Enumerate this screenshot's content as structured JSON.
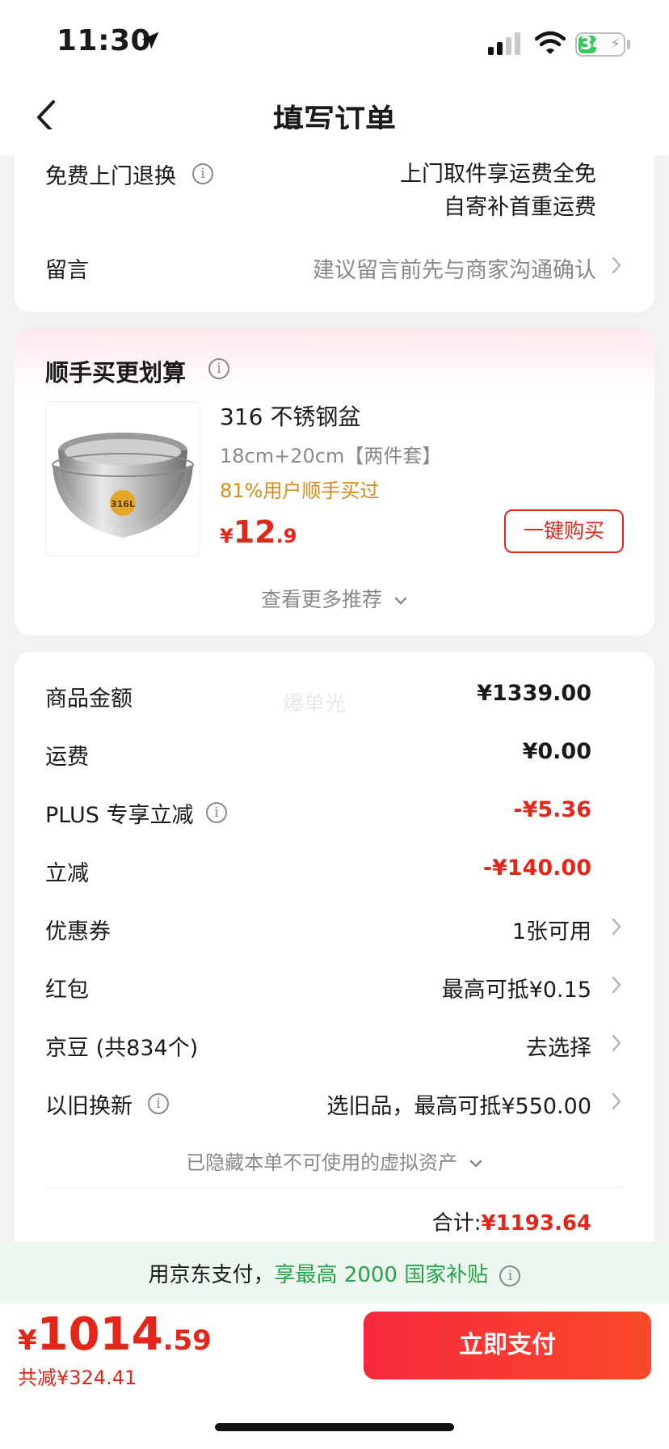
{
  "status": {
    "time": "11:30",
    "battery": "34"
  },
  "nav": {
    "title": "填写订单"
  },
  "service": {
    "return_label": "免费上门退换",
    "return_line1": "上门取件享运费全免",
    "return_line2": "自寄补首重运费",
    "message_label": "留言",
    "message_placeholder": "建议留言前先与商家沟通确认"
  },
  "recommend": {
    "title": "顺手买更划算",
    "product_name": "316 不锈钢盆",
    "product_spec": "18cm+20cm【两件套】",
    "product_tag": "81%用户顺手买过",
    "price_symbol": "¥",
    "price_int": "12",
    "price_dec": ".9",
    "buy_label": "一键购买",
    "more_label": "查看更多推荐"
  },
  "summary": {
    "watermark": "爆单光",
    "rows": [
      {
        "label": "商品金额",
        "value": "¥1339.00"
      },
      {
        "label": "运费",
        "value": "¥0.00"
      },
      {
        "label": "PLUS 专享立减",
        "value": "-¥5.36"
      },
      {
        "label": "立减",
        "value": "-¥140.00"
      },
      {
        "label": "优惠券",
        "value": "1张可用"
      },
      {
        "label": "红包",
        "value": "最高可抵¥0.15"
      },
      {
        "label": "京豆 (共834个)",
        "value": "去选择"
      },
      {
        "label": "以旧换新",
        "value": "选旧品，最高可抵¥550.00"
      }
    ],
    "hidden_assets": "已隐藏本单不可使用的虚拟资产",
    "total_label": "合计:",
    "total_value": "¥1193.64"
  },
  "jdpay": {
    "prefix": "用京东支付，",
    "highlight": "享最高 2000 国家补贴"
  },
  "footer": {
    "price_symbol": "¥",
    "price_int": "1014",
    "price_dec": ".59",
    "saved": "共减¥324.41",
    "pay_label": "立即支付"
  },
  "colors": {
    "accent_red": "#e4261a",
    "green": "#25a24a",
    "tag_orange": "#d98c1a"
  }
}
